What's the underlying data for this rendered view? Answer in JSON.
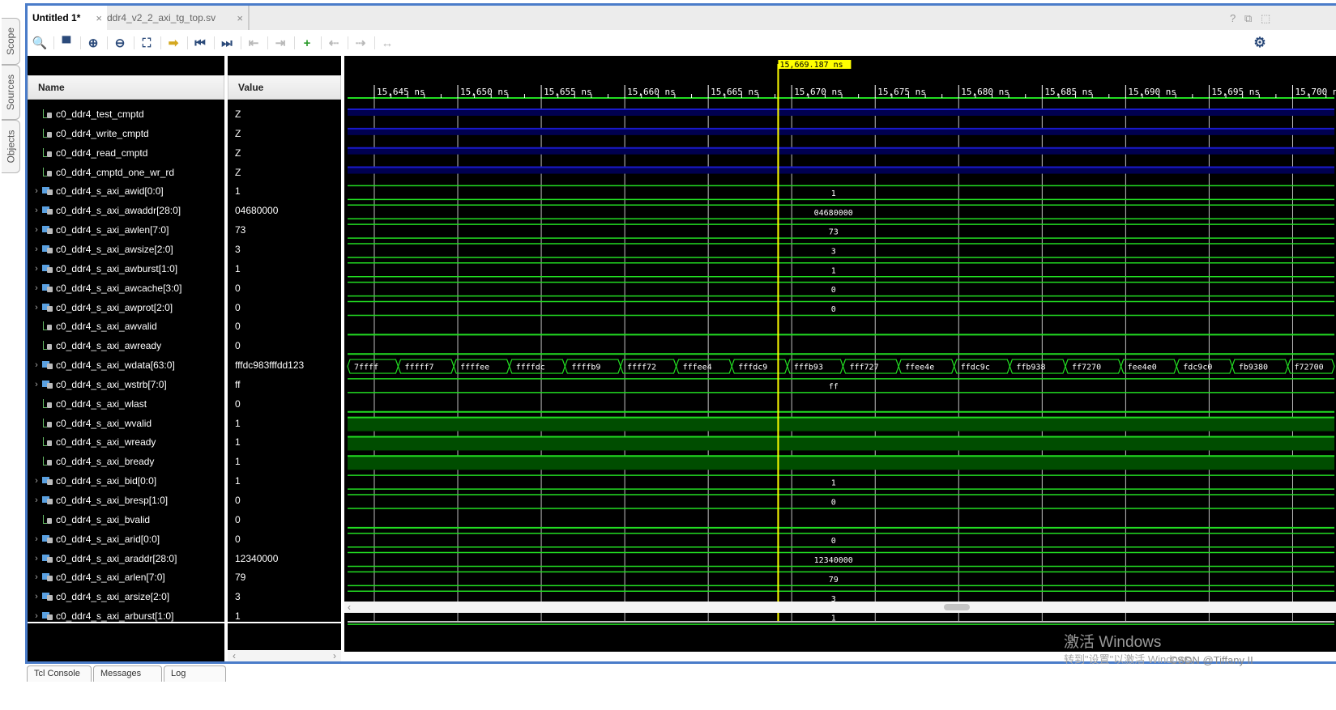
{
  "side_tabs": [
    "Scope",
    "Sources",
    "Objects"
  ],
  "editor_tabs": [
    {
      "label": "Untitled 1*",
      "active": true
    },
    {
      "label": "ddr4_v2_2_axi_tg_top.sv",
      "active": false
    }
  ],
  "window_controls": {
    "help": "?",
    "restore": "⧉",
    "maximize": "⬚"
  },
  "toolbar": [
    {
      "name": "search-icon",
      "glyph": "🔍",
      "enabled": true
    },
    {
      "name": "save-icon",
      "glyph": "▀",
      "enabled": true
    },
    {
      "name": "zoom-in-icon",
      "glyph": "⊕",
      "enabled": true
    },
    {
      "name": "zoom-out-icon",
      "glyph": "⊖",
      "enabled": true
    },
    {
      "name": "zoom-fit-icon",
      "glyph": "⛶",
      "enabled": true
    },
    {
      "name": "go-to-cursor-icon",
      "glyph": "➡",
      "enabled": true
    },
    {
      "name": "go-to-start-icon",
      "glyph": "⏮",
      "enabled": true
    },
    {
      "name": "go-to-end-icon",
      "glyph": "⏭",
      "enabled": true
    },
    {
      "name": "previous-transition-icon",
      "glyph": "⇤",
      "enabled": false
    },
    {
      "name": "next-transition-icon",
      "glyph": "⇥",
      "enabled": false
    },
    {
      "name": "add-marker-icon",
      "glyph": "+",
      "enabled": true
    },
    {
      "name": "previous-marker-icon",
      "glyph": "⇠",
      "enabled": false
    },
    {
      "name": "next-marker-icon",
      "glyph": "⇢",
      "enabled": false
    },
    {
      "name": "swap-cursors-icon",
      "glyph": "↔",
      "enabled": false
    }
  ],
  "settings_icon": "⚙",
  "columns": {
    "name": "Name",
    "value": "Value"
  },
  "signals": [
    {
      "name": "c0_ddr4_test_cmptd",
      "value": "Z",
      "kind": "logic",
      "wave": "z"
    },
    {
      "name": "c0_ddr4_write_cmptd",
      "value": "Z",
      "kind": "logic",
      "wave": "z"
    },
    {
      "name": "c0_ddr4_read_cmptd",
      "value": "Z",
      "kind": "logic",
      "wave": "z"
    },
    {
      "name": "c0_ddr4_cmptd_one_wr_rd",
      "value": "Z",
      "kind": "logic",
      "wave": "z"
    },
    {
      "name": "c0_ddr4_s_axi_awid[0:0]",
      "value": "1",
      "kind": "bus",
      "wave": "bus",
      "label": "1"
    },
    {
      "name": "c0_ddr4_s_axi_awaddr[28:0]",
      "value": "04680000",
      "kind": "bus",
      "wave": "bus",
      "label": "04680000"
    },
    {
      "name": "c0_ddr4_s_axi_awlen[7:0]",
      "value": "73",
      "kind": "bus",
      "wave": "bus",
      "label": "73"
    },
    {
      "name": "c0_ddr4_s_axi_awsize[2:0]",
      "value": "3",
      "kind": "bus",
      "wave": "bus",
      "label": "3"
    },
    {
      "name": "c0_ddr4_s_axi_awburst[1:0]",
      "value": "1",
      "kind": "bus",
      "wave": "bus",
      "label": "1"
    },
    {
      "name": "c0_ddr4_s_axi_awcache[3:0]",
      "value": "0",
      "kind": "bus",
      "wave": "bus",
      "label": "0"
    },
    {
      "name": "c0_ddr4_s_axi_awprot[2:0]",
      "value": "0",
      "kind": "bus",
      "wave": "bus",
      "label": "0"
    },
    {
      "name": "c0_ddr4_s_axi_awvalid",
      "value": "0",
      "kind": "logic",
      "wave": "low"
    },
    {
      "name": "c0_ddr4_s_axi_awready",
      "value": "0",
      "kind": "logic",
      "wave": "low"
    },
    {
      "name": "c0_ddr4_s_axi_wdata[63:0]",
      "value": "fffdc983fffdd123",
      "kind": "bus",
      "wave": "bus_seq",
      "segments": [
        "7ffff",
        "fffff7",
        "ffffee",
        "ffffdc",
        "ffffb9",
        "ffff72",
        "fffee4",
        "fffdc9",
        "fffb93",
        "fff727",
        "ffee4e",
        "ffdc9c",
        "ffb938",
        "ff7270",
        "fee4e0",
        "fdc9c0",
        "fb9380",
        "f72700"
      ]
    },
    {
      "name": "c0_ddr4_s_axi_wstrb[7:0]",
      "value": "ff",
      "kind": "bus",
      "wave": "bus",
      "label": "ff"
    },
    {
      "name": "c0_ddr4_s_axi_wlast",
      "value": "0",
      "kind": "logic",
      "wave": "low"
    },
    {
      "name": "c0_ddr4_s_axi_wvalid",
      "value": "1",
      "kind": "logic",
      "wave": "high"
    },
    {
      "name": "c0_ddr4_s_axi_wready",
      "value": "1",
      "kind": "logic",
      "wave": "high"
    },
    {
      "name": "c0_ddr4_s_axi_bready",
      "value": "1",
      "kind": "logic",
      "wave": "high"
    },
    {
      "name": "c0_ddr4_s_axi_bid[0:0]",
      "value": "1",
      "kind": "bus",
      "wave": "bus",
      "label": "1"
    },
    {
      "name": "c0_ddr4_s_axi_bresp[1:0]",
      "value": "0",
      "kind": "bus",
      "wave": "bus",
      "label": "0"
    },
    {
      "name": "c0_ddr4_s_axi_bvalid",
      "value": "0",
      "kind": "logic",
      "wave": "low"
    },
    {
      "name": "c0_ddr4_s_axi_arid[0:0]",
      "value": "0",
      "kind": "bus",
      "wave": "bus",
      "label": "0"
    },
    {
      "name": "c0_ddr4_s_axi_araddr[28:0]",
      "value": "12340000",
      "kind": "bus",
      "wave": "bus",
      "label": "12340000"
    },
    {
      "name": "c0_ddr4_s_axi_arlen[7:0]",
      "value": "79",
      "kind": "bus",
      "wave": "bus",
      "label": "79"
    },
    {
      "name": "c0_ddr4_s_axi_arsize[2:0]",
      "value": "3",
      "kind": "bus",
      "wave": "bus",
      "label": "3"
    },
    {
      "name": "c0_ddr4_s_axi_arburst[1:0]",
      "value": "1",
      "kind": "bus",
      "wave": "bus",
      "label": "1"
    }
  ],
  "timeline": {
    "unit": "ns",
    "start_ns": 15643.4,
    "end_ns": 15702.5,
    "major_ticks_ns": [
      15645,
      15650,
      15655,
      15660,
      15665,
      15670,
      15675,
      15680,
      15685,
      15690,
      15695,
      15700
    ],
    "tick_labels": [
      "15,645 ns",
      "15,650 ns",
      "15,655 ns",
      "15,660 ns",
      "15,665 ns",
      "15,670 ns",
      "15,675 ns",
      "15,680 ns",
      "15,685 ns",
      "15,690 ns",
      "15,695 ns",
      "15,700 ns"
    ],
    "cursor_ns": 15669.187,
    "cursor_label": "15,669.187 ns",
    "wdata_period_ns": 3.33
  },
  "colors": {
    "wave_green": "#22dd22",
    "high_fill": "#004d00",
    "z_blue": "#1a1acc",
    "z_fill": "#000050",
    "cursor": "#ffff00",
    "grid": "#c0c0c0",
    "frame_accent": "#4a7cc9"
  },
  "bottom_tabs": [
    "Tcl Console",
    "Messages",
    "Log"
  ],
  "watermark": {
    "line1": "激活 Windows",
    "line2": "转到\"设置\"以激活 Windows。",
    "credit": "CSDN @Tiffany II"
  }
}
